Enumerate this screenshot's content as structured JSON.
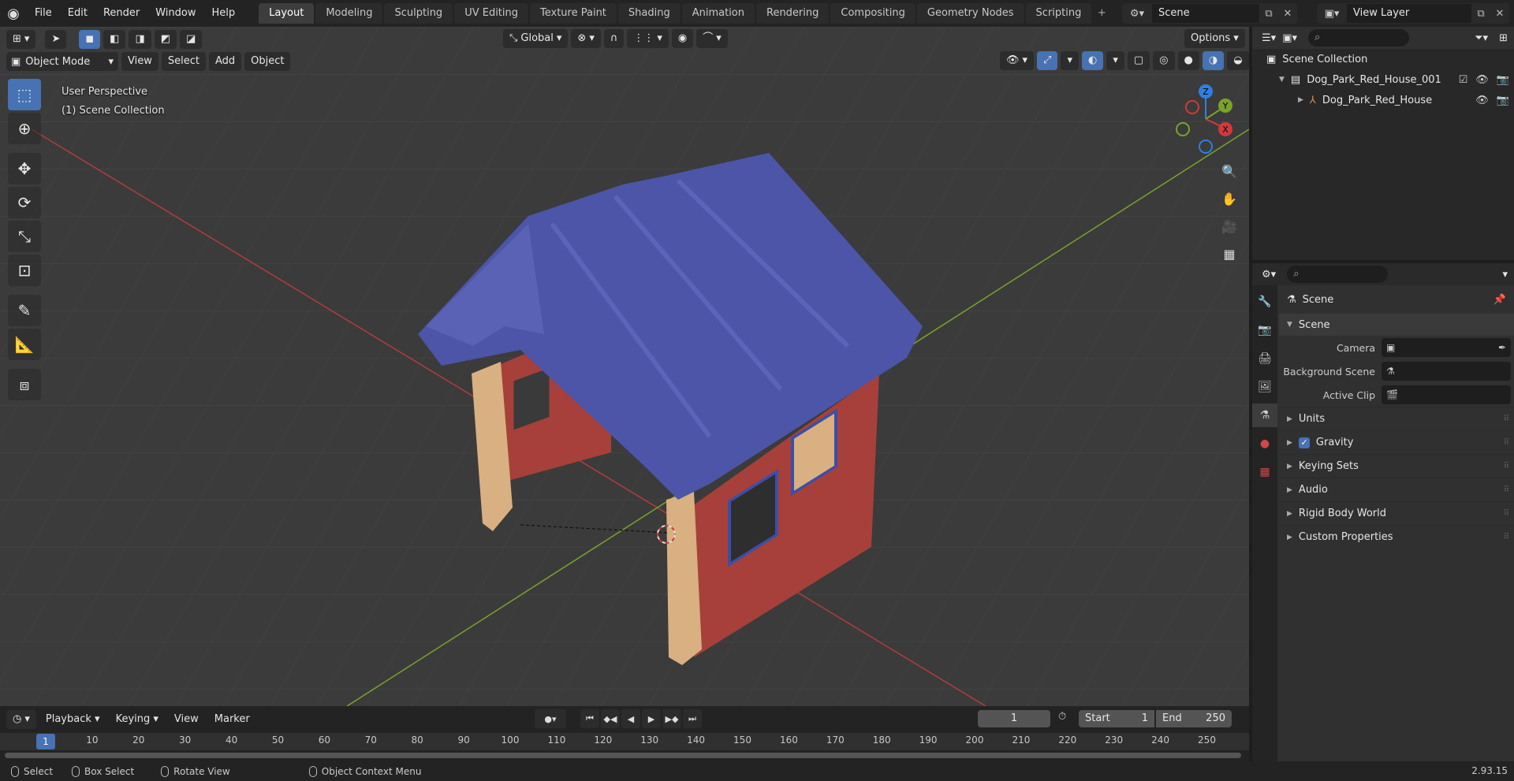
{
  "app": {
    "menus": [
      "File",
      "Edit",
      "Render",
      "Window",
      "Help"
    ],
    "workspaces": [
      {
        "label": "Layout",
        "active": true
      },
      {
        "label": "Modeling"
      },
      {
        "label": "Sculpting"
      },
      {
        "label": "UV Editing"
      },
      {
        "label": "Texture Paint"
      },
      {
        "label": "Shading"
      },
      {
        "label": "Animation"
      },
      {
        "label": "Rendering"
      },
      {
        "label": "Compositing"
      },
      {
        "label": "Geometry Nodes"
      },
      {
        "label": "Scripting"
      }
    ],
    "scene_name": "Scene",
    "view_layer": "View Layer"
  },
  "viewport": {
    "mode": "Object Mode",
    "menus": [
      "View",
      "Select",
      "Add",
      "Object"
    ],
    "transform_orientation": "Global",
    "options_label": "Options",
    "overlay_title": "User Perspective",
    "overlay_collection": "(1) Scene Collection",
    "gizmo_axes": {
      "z": "Z",
      "y": "Y",
      "x": "X"
    },
    "colors": {
      "grid_bg": "#3b3b3b",
      "x_axis": "#c0393f",
      "y_axis": "#7aa32b",
      "roof": "#4c55a8",
      "wall": "#a7403a",
      "wood": "#d9b081",
      "window": "#3a4fa8",
      "accent": "#4772b3"
    }
  },
  "timeline": {
    "menus": [
      "Playback",
      "Keying",
      "View",
      "Marker"
    ],
    "current_frame": "1",
    "start_label": "Start",
    "start_value": "1",
    "end_label": "End",
    "end_value": "250",
    "ticks": [
      "10",
      "20",
      "30",
      "40",
      "50",
      "60",
      "70",
      "80",
      "90",
      "100",
      "110",
      "120",
      "130",
      "140",
      "150",
      "160",
      "170",
      "180",
      "190",
      "200",
      "210",
      "220",
      "230",
      "240",
      "250"
    ],
    "ruler_current": "1"
  },
  "status": {
    "select": "Select",
    "box_select": "Box Select",
    "rotate_view": "Rotate View",
    "context_menu": "Object Context Menu",
    "version": "2.93.15"
  },
  "outliner": {
    "root": "Scene Collection",
    "collection": "Dog_Park_Red_House_001",
    "object": "Dog_Park_Red_House"
  },
  "properties": {
    "title": "Scene",
    "panel": "Scene",
    "camera_label": "Camera",
    "background_scene_label": "Background Scene",
    "active_clip_label": "Active Clip",
    "sub_panels": [
      "Units",
      "Gravity",
      "Keying Sets",
      "Audio",
      "Rigid Body World",
      "Custom Properties"
    ],
    "gravity_checked": true
  }
}
